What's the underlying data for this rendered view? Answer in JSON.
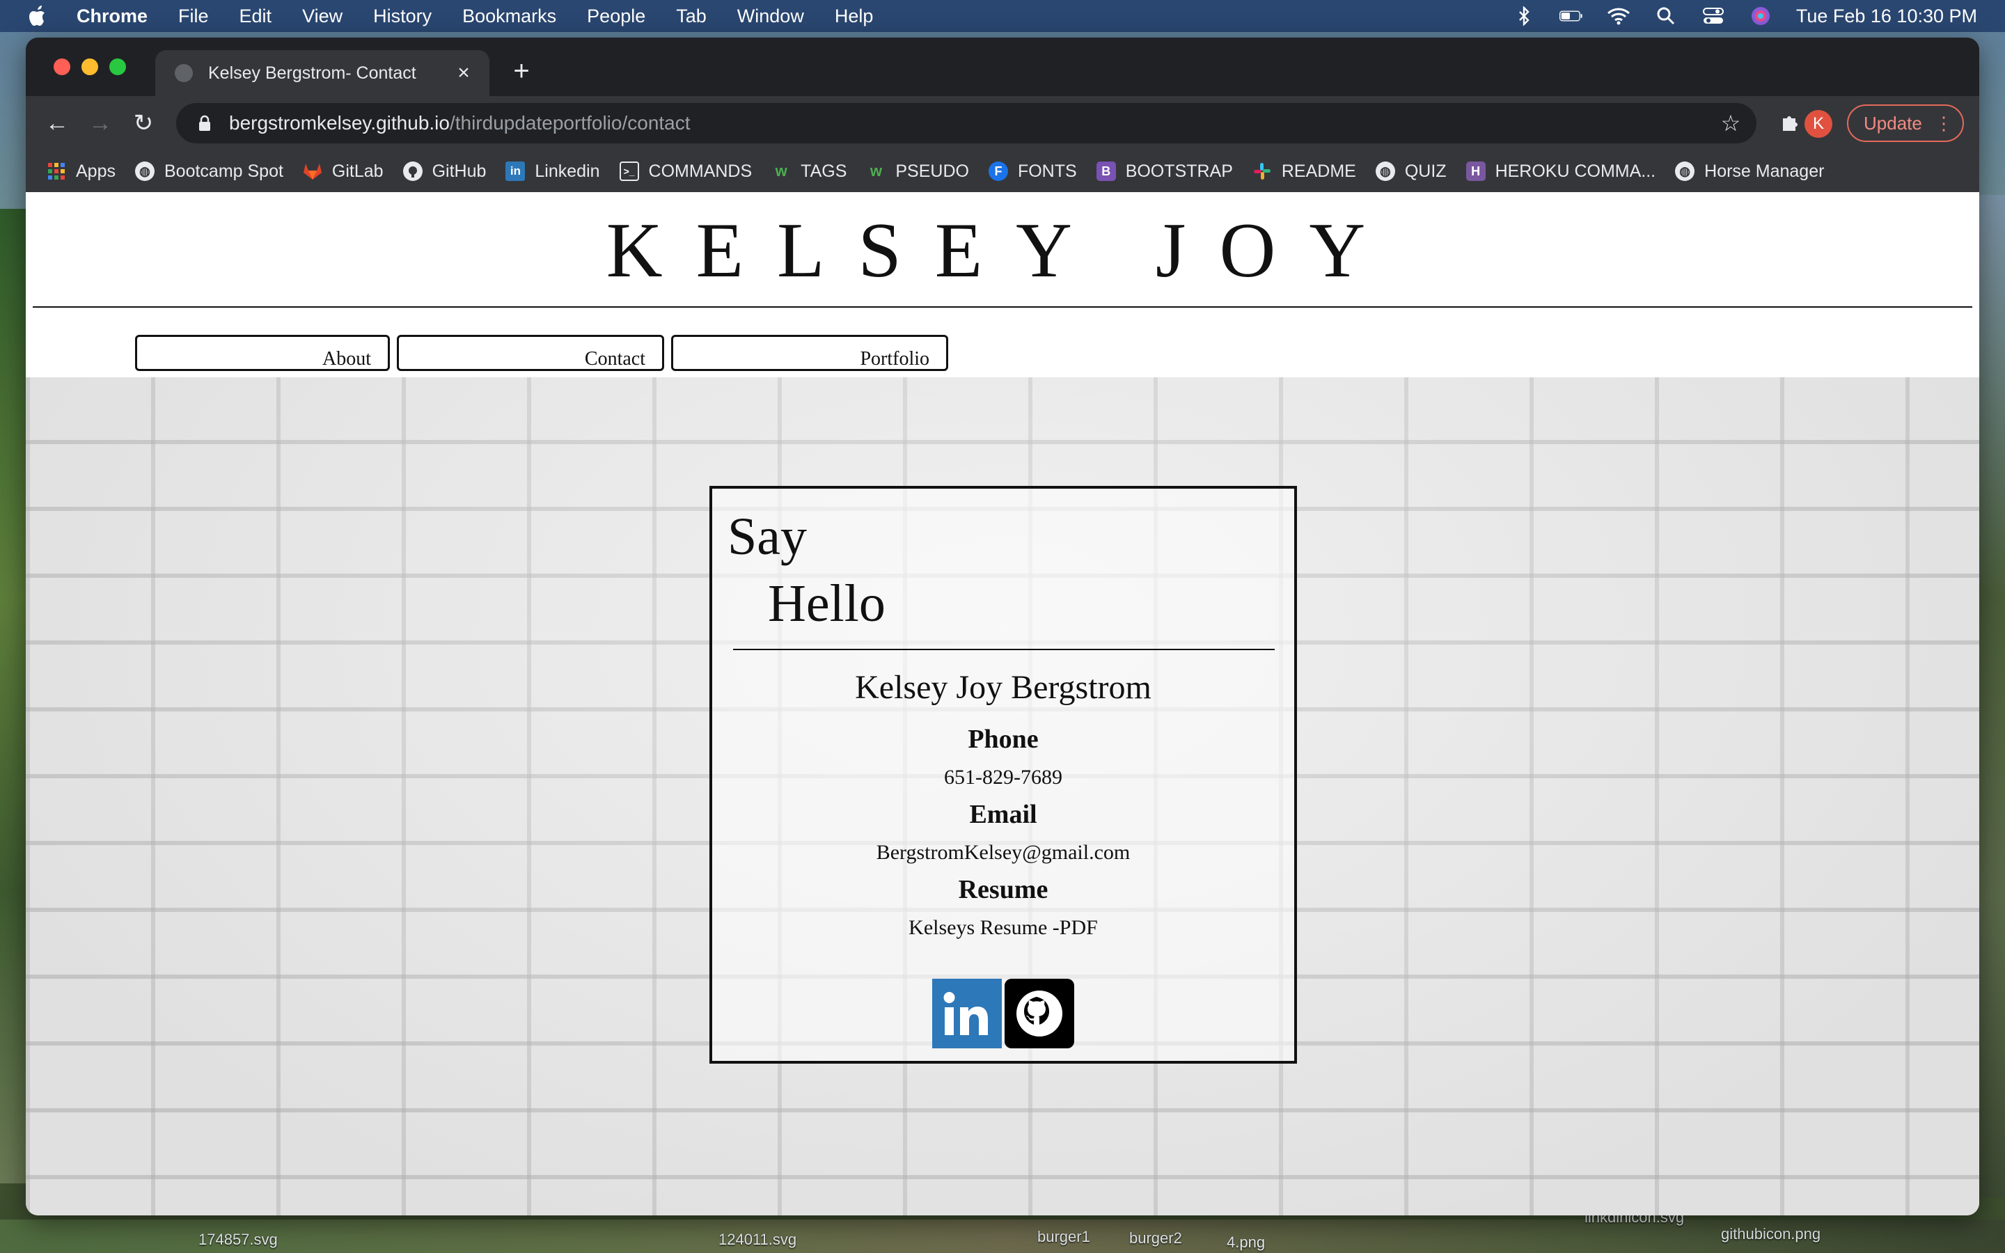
{
  "menubar": {
    "app": "Chrome",
    "items": [
      "File",
      "Edit",
      "View",
      "History",
      "Bookmarks",
      "People",
      "Tab",
      "Window",
      "Help"
    ],
    "datetime": "Tue Feb 16  10:30 PM"
  },
  "browser": {
    "tab_title": "Kelsey Bergstrom- Contact",
    "url_host": "bergstromkelsey.github.io",
    "url_path": "/thirdupdateportfolio/contact",
    "profile_initial": "K",
    "update_label": "Update",
    "bookmarks": [
      {
        "label": "Apps",
        "icon": "apps-grid-icon",
        "color": "#e8453c"
      },
      {
        "label": "Bootcamp Spot",
        "icon": "globe-icon",
        "color": "#e8eaed"
      },
      {
        "label": "GitLab",
        "icon": "gitlab-icon",
        "color": "#e24329"
      },
      {
        "label": "GitHub",
        "icon": "github-icon",
        "color": "#e8eaed"
      },
      {
        "label": "Linkedin",
        "icon": "linkedin-icon",
        "color": "#2d78b8"
      },
      {
        "label": "COMMANDS",
        "icon": "terminal-icon",
        "color": "#e8eaed"
      },
      {
        "label": "TAGS",
        "icon": "w3-icon",
        "color": "#4caf50"
      },
      {
        "label": "PSEUDO",
        "icon": "w3-icon",
        "color": "#4caf50"
      },
      {
        "label": "FONTS",
        "icon": "fonts-icon",
        "color": "#1a73e8"
      },
      {
        "label": "BOOTSTRAP",
        "icon": "bootstrap-icon",
        "color": "#7952b3"
      },
      {
        "label": "README",
        "icon": "slack-icon",
        "color": "#e01e5a"
      },
      {
        "label": "QUIZ",
        "icon": "globe-icon",
        "color": "#e8eaed"
      },
      {
        "label": "HEROKU COMMA...",
        "icon": "heroku-icon",
        "color": "#79589f"
      },
      {
        "label": "Horse Manager",
        "icon": "globe-icon",
        "color": "#e8eaed"
      }
    ]
  },
  "page": {
    "site_title": "KELSEY JOY",
    "nav": [
      "About",
      "Contact",
      "Portfolio"
    ],
    "card": {
      "say": "Say",
      "hello": "Hello",
      "name": "Kelsey Joy Bergstrom",
      "phone_label": "Phone",
      "phone": "651-829-7689",
      "email_label": "Email",
      "email": "BergstromKelsey@gmail.com",
      "resume_label": "Resume",
      "resume_link": "Kelseys Resume -PDF"
    }
  },
  "desktop": {
    "files": [
      "174857.svg",
      "124011.svg",
      "burger1",
      "burger2",
      "4.png",
      "linkdinicon.svg",
      "githubicon.png"
    ]
  }
}
